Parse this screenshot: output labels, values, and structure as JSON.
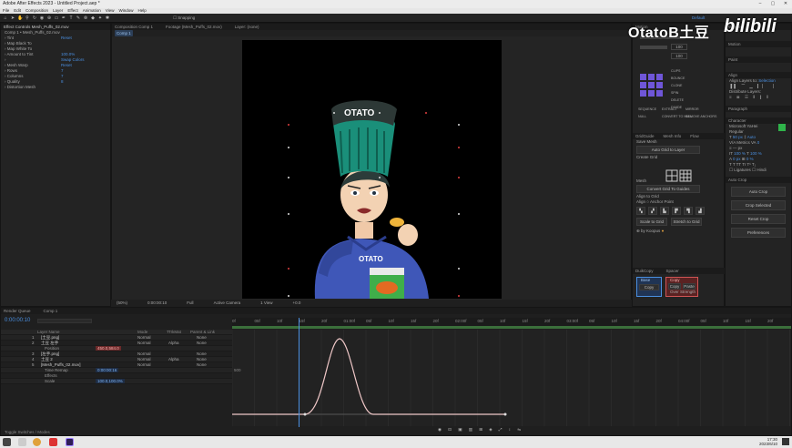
{
  "app": {
    "title": "Adobe After Effects 2023 - Untitled Project.aep *",
    "menu": [
      "File",
      "Edit",
      "Composition",
      "Layer",
      "Effect",
      "Animation",
      "View",
      "Window",
      "Help"
    ],
    "toolbar": {
      "snapping": "Snapping",
      "default": "Default"
    }
  },
  "watermark": {
    "text": "OtatoB土豆",
    "logo": "bilibili"
  },
  "effects_panel": {
    "tab": "Effect Controls Mesh_Puffs_02.mov",
    "comp_line": "Comp 1 • Mesh_Puffs_02.mov",
    "rows": [
      {
        "label": "Tint",
        "v": "Reset"
      },
      {
        "label": "Map Black To",
        "v": ""
      },
      {
        "label": "Map White To",
        "v": ""
      },
      {
        "label": "Amount to Tint",
        "v": "100.0%"
      },
      {
        "label": "",
        "v": "Swap Colors"
      },
      {
        "label": "Mesh Warp",
        "v": "Reset"
      },
      {
        "label": "Rows",
        "v": "7"
      },
      {
        "label": "Columns",
        "v": "7"
      },
      {
        "label": "Quality",
        "v": "8"
      },
      {
        "label": "Distortion Mesh",
        "v": ""
      }
    ]
  },
  "composition": {
    "tabs": [
      "Composition Comp 1",
      "Footage (Mesh_Puffs_02.mov)",
      "Layer: (none)"
    ],
    "sub_tab": "Comp 1",
    "bottom": [
      "(50%)",
      "0:00:00:10",
      "Full",
      "Active Camera",
      "1 View",
      "+0.0"
    ]
  },
  "character": {
    "hat_text": "OTATO",
    "shirt_text": "OTATO"
  },
  "right_panel": {
    "motion_tabs": [
      "Motion"
    ],
    "labels": [
      "CLIPS",
      "BOUNCE",
      "CLONE",
      "SPIN",
      "DELETE",
      "DIVIDE",
      "SEQUENCE",
      "EXTRACT",
      "MIRROR",
      "NULL",
      "CONVERT TO NULL",
      "REMOVE ANCHORS"
    ],
    "dropdown_1": "100",
    "dropdown_2": "100",
    "slider_value_1": "0",
    "slider_value_2": "0",
    "grid_tabs": [
      "GridGuide",
      "Mesh Info",
      "Flow"
    ],
    "grid_opts": [
      "Save Mesh",
      "Create Grid",
      "Mesh",
      "Grid"
    ],
    "grid_buttons": [
      "Auto Grid to Layer",
      "Convert Grid To Guides",
      "Align to Grid",
      "Scale to Grid",
      "Stretch to Grid"
    ],
    "grid_radio": [
      "Align",
      "Anchor Point"
    ],
    "scriptname": "by Koopus",
    "duik_tabs": [
      "DuikCopy",
      "Spacer"
    ],
    "duik_buttons": [
      "Copy",
      "Paste",
      "Copy",
      "Paste",
      "Over Strength"
    ],
    "duik_sides": [
      "Base",
      "Copy"
    ]
  },
  "far_right": {
    "panels": [
      "Wiggle",
      "Motion",
      "Paint",
      "Align",
      "Paragraph",
      "Character",
      "Auto Crop"
    ],
    "align_labels": [
      "Align Layers to:",
      "Selection",
      "Distribute Layers:"
    ],
    "character": {
      "font": "Microsoft YaHei",
      "style": "Regular",
      "size": "50 px",
      "leading": "Auto",
      "tracking": "0",
      "kerning": "Metrics",
      "scale_v": "100 %",
      "scale_h": "100 %",
      "baseline": "0 px",
      "tsume": "0 %"
    },
    "auto_crop": [
      "Auto Crop",
      "Crop Selected",
      "Reset Crop",
      "Preferences"
    ]
  },
  "timeline": {
    "tabs": [
      "Render Queue",
      "Comp 1"
    ],
    "timecode": "0:00:00:10",
    "headers": [
      "Layer Name",
      "Mode",
      "T",
      "TrkMat",
      "Parent & Link"
    ],
    "layers": [
      {
        "num": "1",
        "name": "[土豆.png]",
        "mode": "Normal",
        "trk": "",
        "parent": "None"
      },
      {
        "num": "2",
        "name": "土豆 左手",
        "mode": "Normal",
        "trk": "Alpha",
        "parent": "None"
      },
      {
        "num": "",
        "name": "Position",
        "mode": "",
        "trk": "",
        "parent": "",
        "value": "450.0,584.0"
      },
      {
        "num": "3",
        "name": "[左手.png]",
        "mode": "Normal",
        "trk": "",
        "parent": "None"
      },
      {
        "num": "4",
        "name": "土豆 2",
        "mode": "Normal",
        "trk": "Alpha",
        "parent": "None"
      },
      {
        "num": "5",
        "name": "[Mesh_Puffs_02.mov]",
        "mode": "Normal",
        "trk": "",
        "parent": "None"
      },
      {
        "num": "",
        "name": "Time Remap",
        "mode": "",
        "trk": "",
        "parent": "",
        "value": "0:00:00:16"
      },
      {
        "num": "",
        "name": "Effects",
        "mode": "",
        "trk": "",
        "parent": ""
      },
      {
        "num": "",
        "name": "Scale",
        "mode": "",
        "trk": "",
        "parent": "",
        "value": "100.0,100.0%"
      }
    ],
    "ruler": [
      "0f",
      "05f",
      "10f",
      "15f",
      "20f",
      "01:00f",
      "05f",
      "10f",
      "15f",
      "20f",
      "02:00f",
      "05f",
      "10f",
      "15f",
      "20f",
      "03:00f",
      "05f",
      "10f",
      "15f",
      "20f",
      "04:00f",
      "05f",
      "10f",
      "15f",
      "20f"
    ],
    "graph_label": "500",
    "footer": "Toggle Switches / Modes"
  },
  "taskbar": {
    "time": "17:30",
    "date": "2023/6/10"
  },
  "colors": {
    "accent": "#4a8fe0",
    "keyframe": "#e0a040",
    "fill_green": "#2fb34a"
  }
}
